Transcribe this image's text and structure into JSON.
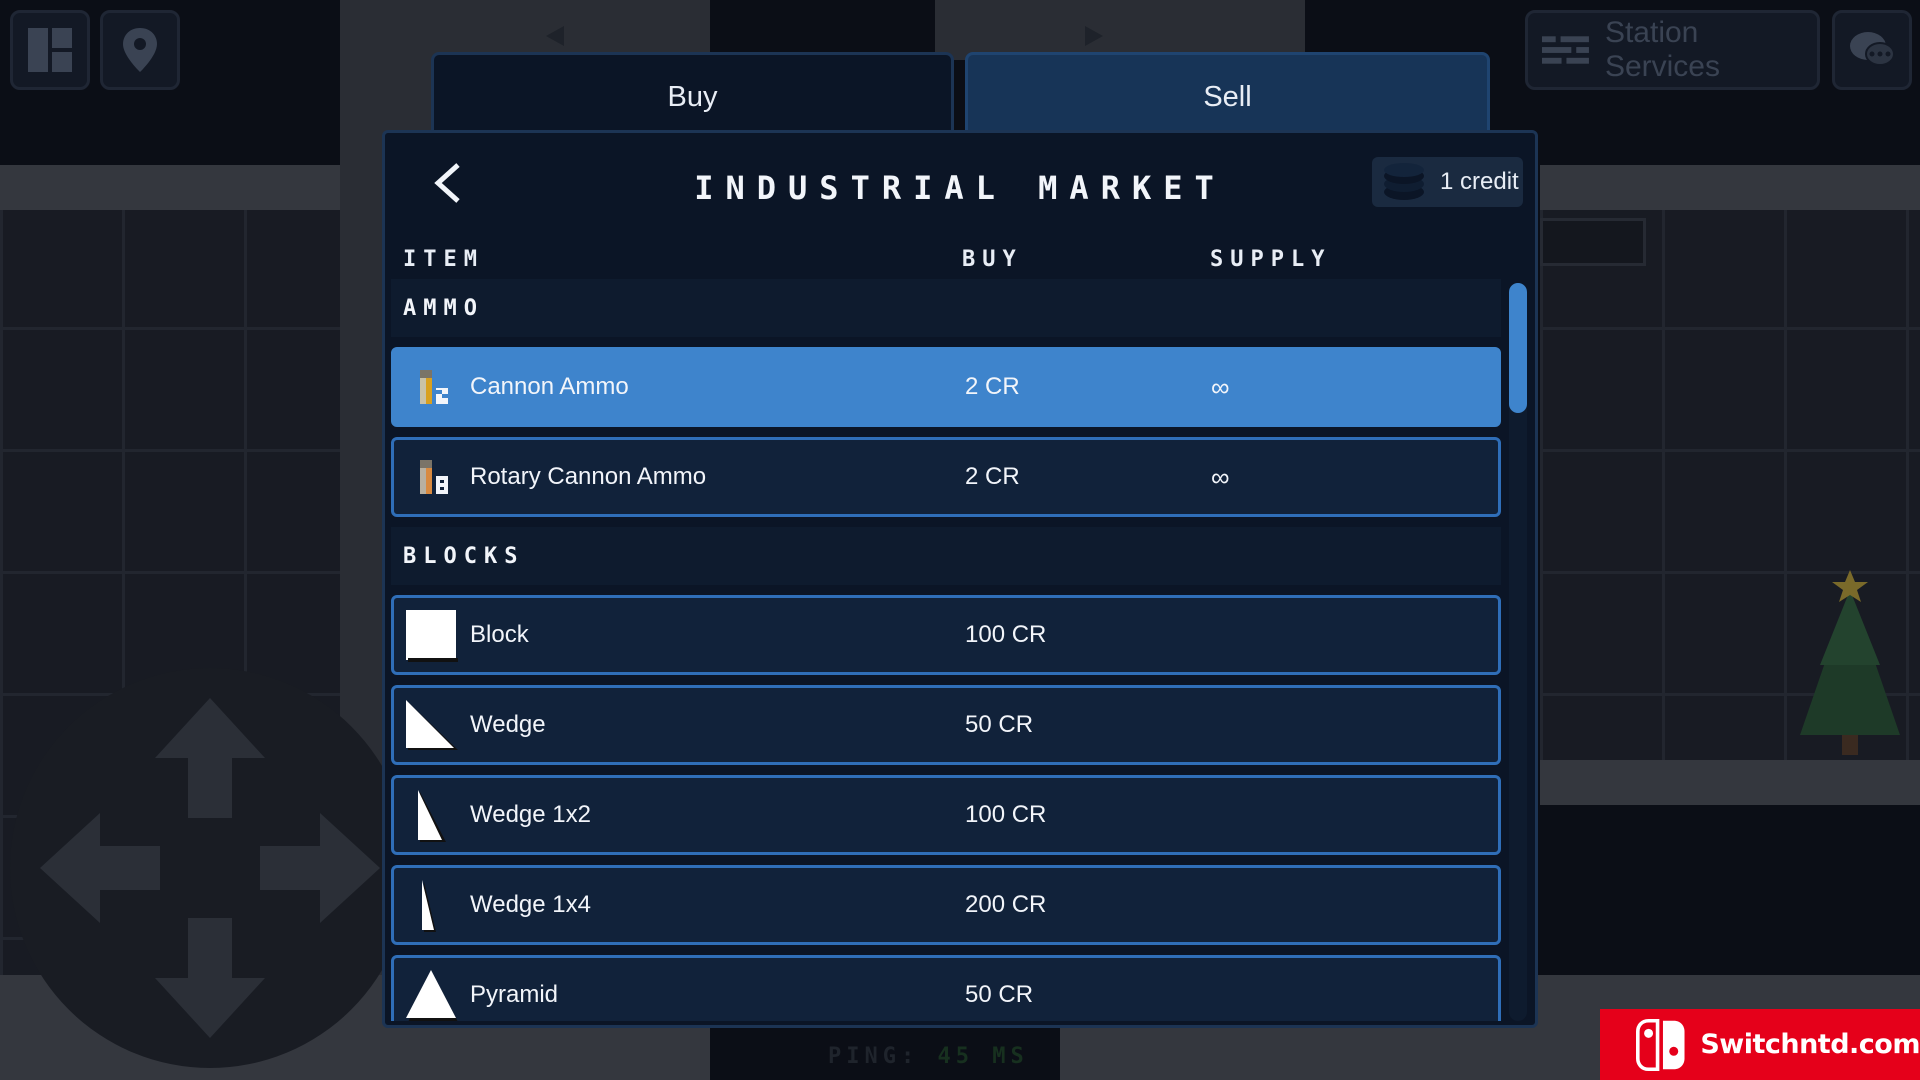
{
  "hud": {
    "station_services_label": "Station Services"
  },
  "tabs": {
    "buy_label": "Buy",
    "sell_label": "Sell",
    "active": "Buy"
  },
  "market": {
    "title": "INDUSTRIAL MARKET",
    "credits_label": "1 credit",
    "columns": {
      "item": "ITEM",
      "buy": "BUY",
      "supply": "SUPPLY"
    },
    "sections": [
      {
        "label": "AMMO",
        "items": [
          {
            "name": "Cannon Ammo",
            "price": "2 CR",
            "supply": "∞",
            "icon": "cannon-ammo-icon",
            "selected": true
          },
          {
            "name": "Rotary Cannon Ammo",
            "price": "2 CR",
            "supply": "∞",
            "icon": "rotary-cannon-ammo-icon",
            "selected": false
          }
        ]
      },
      {
        "label": "BLOCKS",
        "items": [
          {
            "name": "Block",
            "price": "100 CR",
            "supply": "",
            "icon": "block-icon",
            "selected": false
          },
          {
            "name": "Wedge",
            "price": "50 CR",
            "supply": "",
            "icon": "wedge-icon",
            "selected": false
          },
          {
            "name": "Wedge 1x2",
            "price": "100 CR",
            "supply": "",
            "icon": "wedge-1x2-icon",
            "selected": false
          },
          {
            "name": "Wedge 1x4",
            "price": "200 CR",
            "supply": "",
            "icon": "wedge-1x4-icon",
            "selected": false
          },
          {
            "name": "Pyramid",
            "price": "50 CR",
            "supply": "",
            "icon": "pyramid-icon",
            "selected": false
          }
        ]
      }
    ]
  },
  "status": {
    "ping_label": "PING:",
    "ping_value": "45",
    "ping_unit": "MS"
  },
  "watermark": {
    "text": "Switchntd.com"
  },
  "colors": {
    "panel_bg": "#0b1526",
    "row_border": "#2f6eb8",
    "row_selected": "#3e84cc",
    "sell_tab": "#173457",
    "watermark_red": "#e5001a"
  }
}
